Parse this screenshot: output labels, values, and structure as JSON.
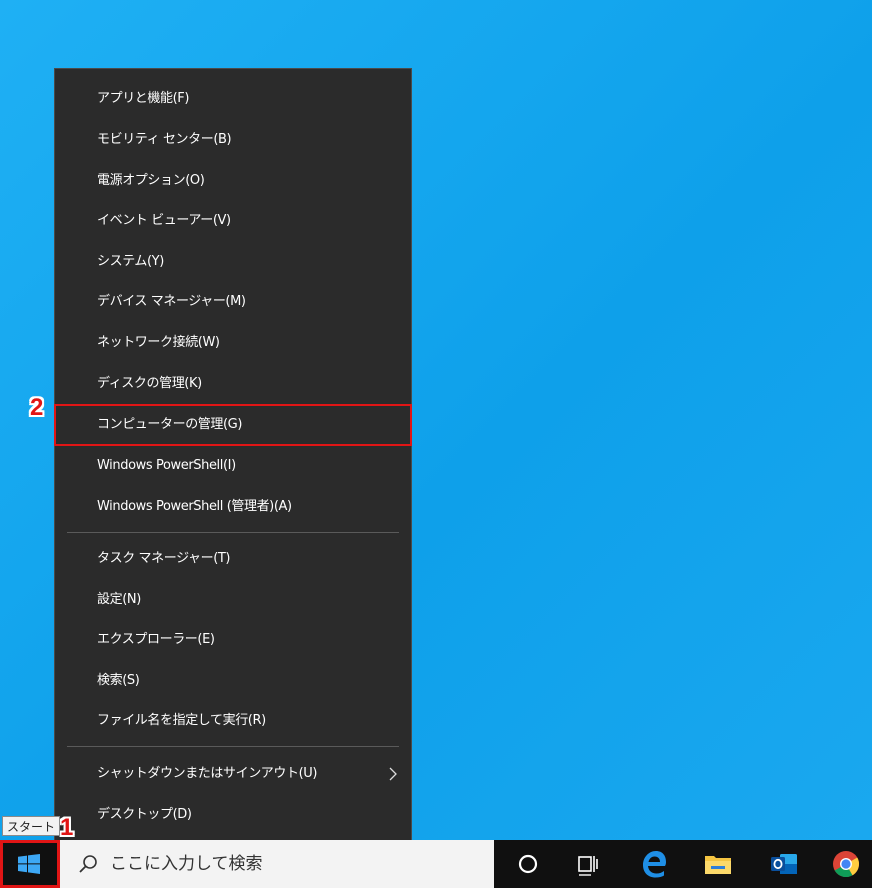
{
  "menu": {
    "items": [
      {
        "label": "アプリと機能(F)"
      },
      {
        "label": "モビリティ センター(B)"
      },
      {
        "label": "電源オプション(O)"
      },
      {
        "label": "イベント ビューアー(V)"
      },
      {
        "label": "システム(Y)"
      },
      {
        "label": "デバイス マネージャー(M)"
      },
      {
        "label": "ネットワーク接続(W)"
      },
      {
        "label": "ディスクの管理(K)"
      },
      {
        "label": "コンピューターの管理(G)",
        "highlighted": true
      },
      {
        "label": "Windows PowerShell(I)"
      },
      {
        "label": "Windows PowerShell (管理者)(A)"
      },
      {
        "label": "タスク マネージャー(T)"
      },
      {
        "label": "設定(N)"
      },
      {
        "label": "エクスプローラー(E)"
      },
      {
        "label": "検索(S)"
      },
      {
        "label": "ファイル名を指定して実行(R)"
      },
      {
        "label": "シャットダウンまたはサインアウト(U)",
        "has_submenu": true
      },
      {
        "label": "デスクトップ(D)"
      }
    ]
  },
  "annotations": {
    "step1": "1",
    "step2": "2"
  },
  "tooltip": {
    "text": "スタート"
  },
  "taskbar": {
    "search_placeholder": "ここに入力して検索",
    "icons": [
      "windows-logo-icon",
      "search-icon",
      "cortana-icon",
      "task-view-icon",
      "edge-icon",
      "file-explorer-icon",
      "outlook-icon",
      "chrome-icon"
    ]
  },
  "colors": {
    "highlight": "#e11515",
    "menu_bg": "#2b2b2b",
    "desktop": "#14a0e8",
    "taskbar": "#101010"
  }
}
